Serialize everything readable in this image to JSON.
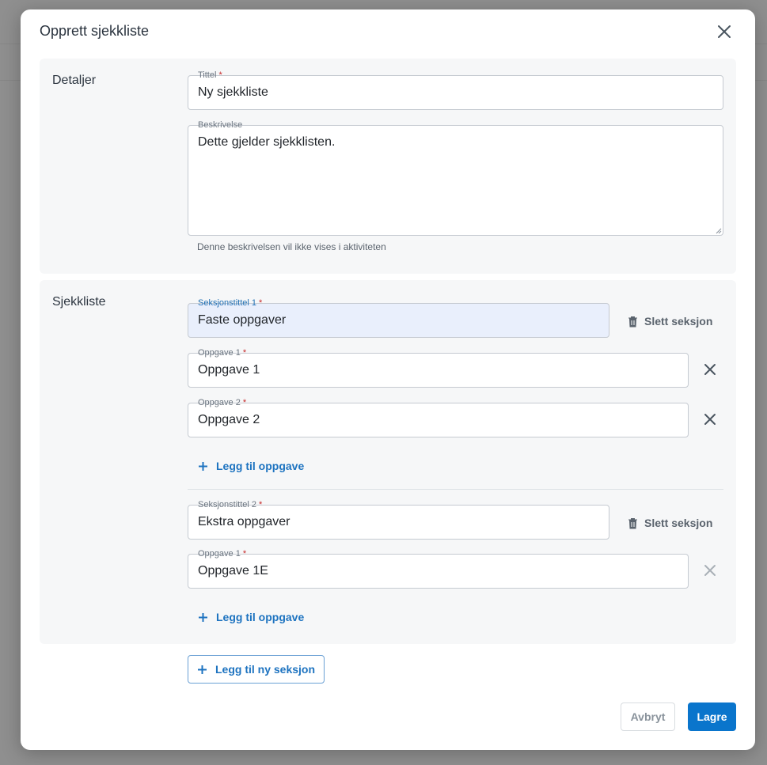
{
  "dialog": {
    "title": "Opprett sjekkliste",
    "close_icon": "close-icon"
  },
  "details": {
    "label": "Detaljer",
    "title_field": {
      "label": "Tittel",
      "required_mark": "*",
      "value": "Ny sjekkliste"
    },
    "description_field": {
      "label": "Beskrivelse",
      "value": "Dette gjelder sjekklisten.",
      "helper": "Denne beskrivelsen vil ikke vises i aktiviteten"
    }
  },
  "checklist": {
    "label": "Sjekkliste",
    "sections": [
      {
        "title_label": "Seksjonstittel 1",
        "title_value": "Faste oppgaver",
        "delete_label": "Slett seksjon",
        "tasks": [
          {
            "label": "Oppgave 1",
            "value": "Oppgave 1"
          },
          {
            "label": "Oppgave 2",
            "value": "Oppgave 2"
          }
        ],
        "add_task_label": "Legg til oppgave"
      },
      {
        "title_label": "Seksjonstittel 2",
        "title_value": "Ekstra oppgaver",
        "delete_label": "Slett seksjon",
        "tasks": [
          {
            "label": "Oppgave 1",
            "value": "Oppgave 1E"
          }
        ],
        "add_task_label": "Legg til oppgave"
      }
    ],
    "add_section_label": "Legg til ny seksjon"
  },
  "footer": {
    "cancel_label": "Avbryt",
    "save_label": "Lagre"
  },
  "colors": {
    "primary": "#0a75cc",
    "link": "#1d73c0",
    "required": "#c62828",
    "active_field_bg": "#e9effc"
  }
}
